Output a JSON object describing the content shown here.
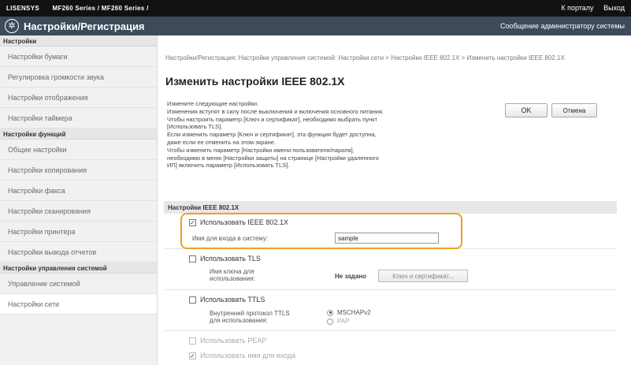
{
  "topbar": {
    "brand": "LISENSYS",
    "model": "MF260 Series / MF260 Series /",
    "portal_link": "К порталу",
    "logout_link": "Выход"
  },
  "header": {
    "title": "Настройки/Регистрация",
    "admin_message": "Сообщение администратору системы",
    "logo_icon": "settings-gear-icon"
  },
  "sidebar": {
    "groups": [
      {
        "heading": "Настройки",
        "items": [
          "Настройки бумаги",
          "Регулировка громкости звука",
          "Настройки отображения",
          "Настройки таймера"
        ]
      },
      {
        "heading": "Настройки функций",
        "items": [
          "Общие настройки",
          "Настройки копирования",
          "Настройки факса",
          "Настройки сканирования",
          "Настройки принтера",
          "Настройки вывода отчетов"
        ]
      },
      {
        "heading": "Настройки управления системой",
        "items": [
          "Управление системой",
          "Настройки сети"
        ]
      }
    ],
    "active_item": "Настройки сети"
  },
  "main": {
    "breadcrumb": "Настройки/Регистрация: Настройки управления системой: Настройки сети > Настройки IEEE 802.1X > Изменить настройки IEEE 802.1X",
    "title": "Изменить настройки IEEE 802.1X",
    "description": [
      "Измените следующие настройки.",
      "Изменения вступят в силу после выключения и включения основного питания.",
      "Чтобы настроить параметр [Ключ и сертификат], необходимо выбрать пункт",
      "[Использовать TLS].",
      "Если изменить параметр [Ключ и сертификат], эта функция будет доступна,",
      "даже если ее отменить на этом экране.",
      "Чтобы изменить параметр [Настройки имени пользователя/пароля],",
      "необходимо в меню [Настройки защиты] на странице [Настройки удаленного",
      "ИП] включить параметр [Использовать TLS]."
    ],
    "ok_button": "OK",
    "cancel_button": "Отмена",
    "section_heading": "Настройки IEEE 802.1X",
    "use_ieee": {
      "label": "Использовать IEEE 802.1X",
      "checked": true
    },
    "login_name": {
      "label": "Имя для входа в систему:",
      "value": "sample"
    },
    "use_tls": {
      "label": "Использовать TLS",
      "checked": false
    },
    "key_name": {
      "label_line1": "Имя ключа для",
      "label_line2": "использования:",
      "value": "Не задано",
      "button": "Ключ и сертификат..."
    },
    "use_ttls": {
      "label": "Использовать TTLS",
      "checked": false
    },
    "ttls_protocol": {
      "label_line1": "Внутренний протокол TTLS",
      "label_line2": "для использования:",
      "options": [
        "MSCHAPv2",
        "PAP"
      ],
      "selected": "MSCHAPv2"
    },
    "use_peap": {
      "label": "Использовать PEAP",
      "checked": false
    },
    "use_login_name": {
      "label": "Использовать имя для входа",
      "checked": true
    }
  }
}
